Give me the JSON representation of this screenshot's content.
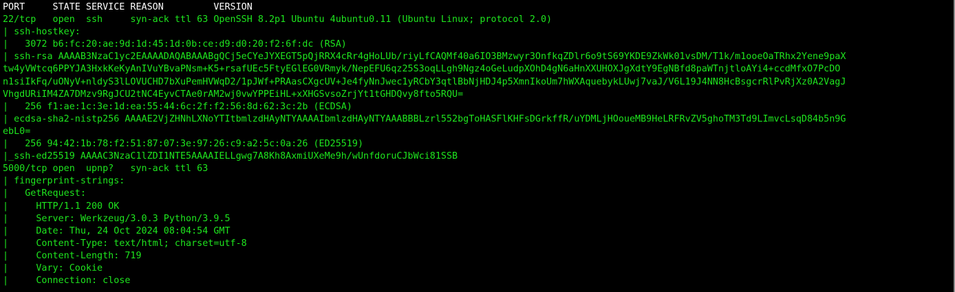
{
  "terminal": {
    "lines": [
      "PORT     STATE SERVICE REASON         VERSION",
      "22/tcp   open  ssh     syn-ack ttl 63 OpenSSH 8.2p1 Ubuntu 4ubuntu0.11 (Ubuntu Linux; protocol 2.0)",
      "| ssh-hostkey:",
      "|   3072 b6:fc:20:ae:9d:1d:45:1d:0b:ce:d9:d0:20:f2:6f:dc (RSA)",
      "| ssh-rsa AAAAB3NzaC1yc2EAAAADAQABAAABgQCj5eCYeJYXEGT5pQjRRX4cRr4gHoLUb/riyLfCAQMf40a6IO3BMzwyr3OnfkqZDlr6o9tS69YKDE9ZkWk01vsDM/T1k/m1ooeOaTRhx2Yene9paX",
      "tw4yVWtcq6PPYJA3HxkKeKyAnIVuYBvaPNsm+K5+rsafUEc5FtyEGlEG0VRmyk/NepEFU6qz25S3oqLLgh9Ngz4oGeLudpXOhD4gN6aHnXXUHOXJgXdtY9EgNBfd8paWTnjtloAYi4+ccdMfxO7PcDO",
      "n1siIkFq/uONyV+nldyS3lLOVUCHD7bXuPemHVWqD2/1pJWf+PRAasCXgcUV+Je4fyNnJwec1yRCbY3qtlBbNjHDJ4p5XmnIkoUm7hWXAquebykLUwj7vaJ/V6L19J4NN8HcBsgcrRlPvRjXz0A2VagJ",
      "VhgdURiIM4ZA7DMzv9RgJCU2tNC4EyvCTAe0rAM2wj0vwYPPEiHL+xXHGSvsoZrjYt1tGHDQvy8fto5RQU=",
      "|   256 f1:ae:1c:3e:1d:ea:55:44:6c:2f:f2:56:8d:62:3c:2b (ECDSA)",
      "| ecdsa-sha2-nistp256 AAAAE2VjZHNhLXNoYTItbmlzdHAyNTYAAAAIbmlzdHAyNTYAAABBBLzrl552bgToHASFlKHFsDGrkffR/uYDMLjHOoueMB9HeLRFRvZV5ghoTM3Td9LImvcLsqD84b5n9G",
      "ebL0=",
      "|   256 94:42:1b:78:f2:51:87:07:3e:97:26:c9:a2:5c:0a:26 (ED25519)",
      "|_ssh-ed25519 AAAAC3NzaC1lZDI1NTE5AAAAIELLgwg7A8Kh8AxmiUXeMe9h/wUnfdoruCJbWci81SSB",
      "5000/tcp open  upnp?   syn-ack ttl 63",
      "| fingerprint-strings:",
      "|   GetRequest:",
      "|     HTTP/1.1 200 OK",
      "|     Server: Werkzeug/3.0.3 Python/3.9.5",
      "|     Date: Thu, 24 Oct 2024 08:04:54 GMT",
      "|     Content-Type: text/html; charset=utf-8",
      "|     Content-Length: 719",
      "|     Vary: Cookie",
      "|     Connection: close"
    ]
  },
  "colors": {
    "background": "#000000",
    "text": "#1ee51e",
    "header": "#ffffff"
  }
}
